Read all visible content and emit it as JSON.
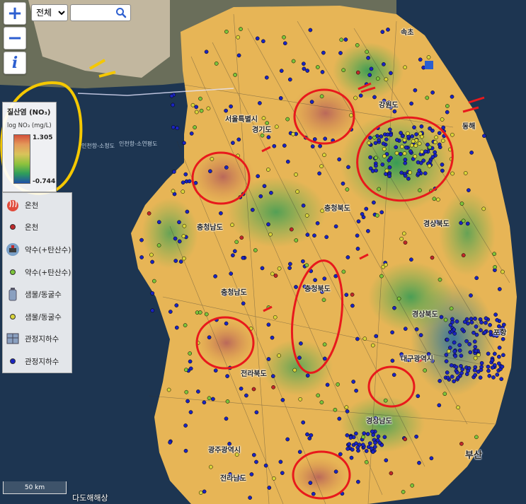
{
  "controls": {
    "zoom_in": "+",
    "zoom_out": "−",
    "info": "i",
    "region_select_value": "전체",
    "search_placeholder": ""
  },
  "legend_no3": {
    "title": "질산염 (NO₃)",
    "unit": "log NO₃ (mg/L)",
    "max": "1.305",
    "min": "-0.744"
  },
  "legend_points": [
    {
      "label": "온천",
      "symbol": "hotspring-icon"
    },
    {
      "label": "온천",
      "color": "#c0282a"
    },
    {
      "label": "약수(+탄산수)",
      "symbol": "mineral-water-icon"
    },
    {
      "label": "약수(+탄산수)",
      "color": "#7cc43a"
    },
    {
      "label": "샘물/동굴수",
      "symbol": "spring-bottle-icon"
    },
    {
      "label": "샘물/동굴수",
      "color": "#d8d43a"
    },
    {
      "label": "관정지하수",
      "symbol": "well-icon"
    },
    {
      "label": "관정지하수",
      "color": "#1a24c0"
    }
  ],
  "place_labels": [
    "속초",
    "강원도",
    "동해",
    "서울특별시",
    "경기도",
    "충청북도",
    "충청남도",
    "경상북도",
    "충청북도",
    "충청남도",
    "경상북도",
    "포항",
    "대구광역시",
    "전라북도",
    "경상남도",
    "광주광역시",
    "전라남도",
    "부산",
    "인천항-소청도",
    "인천항-소연평도"
  ],
  "scale_label": "50 km",
  "attribution": "다도해해상",
  "colors": {
    "high": "#d4503a",
    "mid": "#d9c35a",
    "low": "#2e9e5a",
    "min": "#1f4fa8",
    "annotation": "#e8191c",
    "legend_highlight": "#f5c800"
  }
}
